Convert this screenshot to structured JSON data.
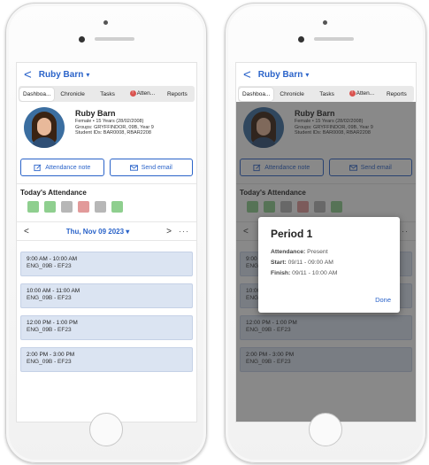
{
  "header": {
    "back": "<",
    "student_name": "Ruby Barn",
    "caret": "▾"
  },
  "tabs": [
    {
      "label": "Dashboa...",
      "active": true
    },
    {
      "label": "Chronicle",
      "active": false
    },
    {
      "label": "Tasks",
      "active": false
    },
    {
      "label": "Atten...",
      "active": false,
      "alert": "!"
    },
    {
      "label": "Reports",
      "active": false
    }
  ],
  "profile": {
    "name": "Ruby Barn",
    "line1": "Female • 15 Years (28/02/2008)",
    "line2": "Groups: GRYFFINDOR, 09B, Year 9",
    "line3": "Student IDs: BAR0008, RBAR2208"
  },
  "actions": {
    "attendance_note": "Attendance note",
    "send_email": "Send email"
  },
  "attendance": {
    "title": "Today's Attendance",
    "squares": [
      "#8fcf8f",
      "#8fcf8f",
      "#b7b7b7",
      "#e29a9a",
      "#b7b7b7",
      "#8fcf8f"
    ]
  },
  "date": {
    "prev": "<",
    "label": "Thu, Nov 09 2023",
    "caret": "▾",
    "next": ">",
    "more": "···"
  },
  "periods": [
    {
      "time": "9:00 AM - 10:00 AM",
      "class": "ENG_09B - EF23"
    },
    {
      "time": "10:00 AM - 11:00 AM",
      "class": "ENG_09B - EF23"
    },
    {
      "time": "12:00 PM - 1:00 PM",
      "class": "ENG_09B - EF23"
    },
    {
      "time": "2:00 PM - 3:00 PM",
      "class": "ENG_09B - EF23"
    }
  ],
  "modal": {
    "title": "Period 1",
    "attendance_label": "Attendance:",
    "attendance_value": "Present",
    "start_label": "Start:",
    "start_value": "09/11 - 09:00 AM",
    "finish_label": "Finish:",
    "finish_value": "09/11 - 10:00 AM",
    "done": "Done"
  },
  "colors": {
    "accent": "#2a63c9",
    "card": "#dbe4f2"
  }
}
